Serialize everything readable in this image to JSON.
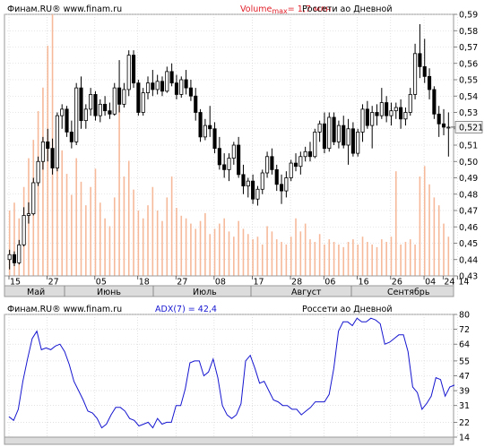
{
  "header_main": {
    "brand": "Финам.RU® www.finam.ru",
    "volume_label": "Volume",
    "volume_sub": "max",
    "volume_value": "= 1,7 млн",
    "title": "Россети ао Дневной"
  },
  "header_adx": {
    "brand": "Финам.RU® www.finam.ru",
    "indicator": "ADX(7) = 42,4",
    "title": "Россети ао Дневной"
  },
  "colors": {
    "up_body": "#ffffff",
    "down_body": "#000000",
    "volume": "#f6b99a",
    "adx_line": "#1515d0",
    "grid": "#cfcfcf",
    "last_price_box": "#f4f4f4"
  },
  "chart_data": [
    {
      "type": "candlestick",
      "title": "Россети ао Дневной",
      "y_ticks": [
        "0,59",
        "0,58",
        "0,57",
        "0,56",
        "0,55",
        "0,54",
        "0,53",
        "0,52",
        "0,51",
        "0,50",
        "0,49",
        "0,48",
        "0,47",
        "0,46",
        "0,45",
        "0,44",
        "0,43"
      ],
      "ylim": [
        0.43,
        0.59
      ],
      "last_price_label": "0,521",
      "last_price": 0.521,
      "x_day_labels": [
        "15",
        "27",
        "05",
        "18",
        "27",
        "08",
        "17",
        "28",
        "06",
        "16",
        "26",
        "04",
        "14",
        "24"
      ],
      "x_month_labels": [
        "Май",
        "Июнь",
        "Июль",
        "Август",
        "Сентябрь"
      ],
      "grid": true,
      "candles": [
        [
          0.44,
          0.446,
          0.434,
          0.443
        ],
        [
          0.443,
          0.445,
          0.436,
          0.438
        ],
        [
          0.438,
          0.452,
          0.437,
          0.449
        ],
        [
          0.449,
          0.472,
          0.448,
          0.467
        ],
        [
          0.467,
          0.475,
          0.462,
          0.468
        ],
        [
          0.468,
          0.49,
          0.467,
          0.487
        ],
        [
          0.487,
          0.503,
          0.485,
          0.5
        ],
        [
          0.5,
          0.515,
          0.495,
          0.512
        ],
        [
          0.512,
          0.52,
          0.5,
          0.508
        ],
        [
          0.508,
          0.514,
          0.492,
          0.496
        ],
        [
          0.496,
          0.53,
          0.494,
          0.528
        ],
        [
          0.528,
          0.535,
          0.52,
          0.532
        ],
        [
          0.532,
          0.534,
          0.515,
          0.518
        ],
        [
          0.518,
          0.525,
          0.508,
          0.512
        ],
        [
          0.512,
          0.548,
          0.51,
          0.545
        ],
        [
          0.545,
          0.552,
          0.52,
          0.525
        ],
        [
          0.525,
          0.535,
          0.52,
          0.532
        ],
        [
          0.532,
          0.545,
          0.528,
          0.541
        ],
        [
          0.541,
          0.543,
          0.525,
          0.528
        ],
        [
          0.528,
          0.538,
          0.524,
          0.535
        ],
        [
          0.535,
          0.54,
          0.528,
          0.531
        ],
        [
          0.531,
          0.536,
          0.526,
          0.529
        ],
        [
          0.529,
          0.548,
          0.528,
          0.545
        ],
        [
          0.545,
          0.562,
          0.53,
          0.535
        ],
        [
          0.535,
          0.548,
          0.533,
          0.544
        ],
        [
          0.544,
          0.568,
          0.54,
          0.565
        ],
        [
          0.565,
          0.568,
          0.545,
          0.548
        ],
        [
          0.548,
          0.55,
          0.528,
          0.53
        ],
        [
          0.53,
          0.545,
          0.528,
          0.542
        ],
        [
          0.542,
          0.552,
          0.538,
          0.548
        ],
        [
          0.548,
          0.556,
          0.54,
          0.544
        ],
        [
          0.544,
          0.553,
          0.541,
          0.549
        ],
        [
          0.549,
          0.552,
          0.54,
          0.543
        ],
        [
          0.543,
          0.558,
          0.542,
          0.555
        ],
        [
          0.555,
          0.56,
          0.546,
          0.548
        ],
        [
          0.548,
          0.553,
          0.538,
          0.541
        ],
        [
          0.541,
          0.552,
          0.539,
          0.55
        ],
        [
          0.55,
          0.556,
          0.541,
          0.545
        ],
        [
          0.545,
          0.55,
          0.537,
          0.54
        ],
        [
          0.54,
          0.545,
          0.525,
          0.53
        ],
        [
          0.53,
          0.532,
          0.512,
          0.515
        ],
        [
          0.515,
          0.526,
          0.513,
          0.522
        ],
        [
          0.522,
          0.534,
          0.515,
          0.52
        ],
        [
          0.52,
          0.524,
          0.505,
          0.508
        ],
        [
          0.508,
          0.515,
          0.495,
          0.498
        ],
        [
          0.498,
          0.505,
          0.49,
          0.495
        ],
        [
          0.495,
          0.505,
          0.488,
          0.502
        ],
        [
          0.502,
          0.512,
          0.498,
          0.51
        ],
        [
          0.51,
          0.515,
          0.49,
          0.492
        ],
        [
          0.492,
          0.498,
          0.48,
          0.485
        ],
        [
          0.485,
          0.49,
          0.478,
          0.488
        ],
        [
          0.488,
          0.492,
          0.474,
          0.477
        ],
        [
          0.477,
          0.485,
          0.473,
          0.483
        ],
        [
          0.483,
          0.495,
          0.48,
          0.493
        ],
        [
          0.493,
          0.506,
          0.49,
          0.503
        ],
        [
          0.503,
          0.508,
          0.492,
          0.495
        ],
        [
          0.495,
          0.498,
          0.482,
          0.486
        ],
        [
          0.486,
          0.492,
          0.474,
          0.482
        ],
        [
          0.482,
          0.494,
          0.478,
          0.49
        ],
        [
          0.49,
          0.501,
          0.488,
          0.499
        ],
        [
          0.499,
          0.505,
          0.494,
          0.497
        ],
        [
          0.497,
          0.506,
          0.492,
          0.503
        ],
        [
          0.503,
          0.509,
          0.5,
          0.506
        ],
        [
          0.506,
          0.512,
          0.5,
          0.503
        ],
        [
          0.503,
          0.52,
          0.502,
          0.518
        ],
        [
          0.518,
          0.525,
          0.512,
          0.523
        ],
        [
          0.523,
          0.53,
          0.505,
          0.508
        ],
        [
          0.508,
          0.53,
          0.506,
          0.527
        ],
        [
          0.527,
          0.53,
          0.51,
          0.512
        ],
        [
          0.512,
          0.525,
          0.508,
          0.522
        ],
        [
          0.522,
          0.528,
          0.508,
          0.51
        ],
        [
          0.51,
          0.526,
          0.498,
          0.52
        ],
        [
          0.52,
          0.524,
          0.503,
          0.505
        ],
        [
          0.505,
          0.52,
          0.503,
          0.518
        ],
        [
          0.518,
          0.535,
          0.512,
          0.532
        ],
        [
          0.532,
          0.537,
          0.52,
          0.522
        ],
        [
          0.522,
          0.534,
          0.508,
          0.53
        ],
        [
          0.53,
          0.535,
          0.522,
          0.528
        ],
        [
          0.528,
          0.545,
          0.526,
          0.536
        ],
        [
          0.536,
          0.54,
          0.524,
          0.528
        ],
        [
          0.528,
          0.536,
          0.522,
          0.531
        ],
        [
          0.531,
          0.536,
          0.526,
          0.533
        ],
        [
          0.533,
          0.538,
          0.52,
          0.526
        ],
        [
          0.526,
          0.533,
          0.522,
          0.53
        ],
        [
          0.53,
          0.545,
          0.528,
          0.541
        ],
        [
          0.541,
          0.572,
          0.538,
          0.566
        ],
        [
          0.566,
          0.584,
          0.551,
          0.558
        ],
        [
          0.558,
          0.575,
          0.548,
          0.552
        ],
        [
          0.552,
          0.557,
          0.538,
          0.544
        ],
        [
          0.544,
          0.546,
          0.526,
          0.529
        ],
        [
          0.529,
          0.534,
          0.515,
          0.523
        ],
        [
          0.523,
          0.532,
          0.516,
          0.521
        ],
        [
          0.521,
          0.53,
          0.503,
          0.521
        ]
      ],
      "volume_bars": [
        0.25,
        0.28,
        0.22,
        0.34,
        0.45,
        0.52,
        0.63,
        0.72,
        0.88,
        1.0,
        0.58,
        0.48,
        0.39,
        0.31,
        0.45,
        0.36,
        0.27,
        0.34,
        0.41,
        0.28,
        0.22,
        0.19,
        0.3,
        0.65,
        0.38,
        0.44,
        0.33,
        0.25,
        0.22,
        0.27,
        0.34,
        0.25,
        0.21,
        0.3,
        0.38,
        0.26,
        0.23,
        0.22,
        0.2,
        0.18,
        0.21,
        0.24,
        0.16,
        0.18,
        0.2,
        0.22,
        0.17,
        0.15,
        0.21,
        0.18,
        0.16,
        0.14,
        0.15,
        0.12,
        0.19,
        0.17,
        0.14,
        0.13,
        0.12,
        0.15,
        0.22,
        0.17,
        0.2,
        0.14,
        0.13,
        0.16,
        0.12,
        0.14,
        0.13,
        0.12,
        0.11,
        0.13,
        0.14,
        0.12,
        0.15,
        0.13,
        0.12,
        0.11,
        0.14,
        0.13,
        0.15,
        0.4,
        0.12,
        0.13,
        0.14,
        0.12,
        0.38,
        0.42,
        0.35,
        0.3,
        0.27,
        0.2,
        0.15
      ]
    },
    {
      "type": "line",
      "title": "Россети ао Дневной",
      "series_name": "ADX(7)",
      "last_value_label": "42,4",
      "y_ticks": [
        "80",
        "72",
        "64",
        "55",
        "47",
        "39",
        "31",
        "22",
        "14"
      ],
      "ylim": [
        14,
        80
      ],
      "grid": true,
      "values": [
        25,
        23,
        29,
        44,
        56,
        67,
        71,
        61,
        62,
        61,
        63,
        64,
        60,
        53,
        44,
        39,
        34,
        28,
        27,
        24,
        19,
        21,
        26,
        30,
        30,
        28,
        24,
        23,
        20,
        21,
        22,
        19,
        24,
        21,
        22,
        22,
        31,
        31,
        40,
        54,
        55,
        55,
        47,
        49,
        56,
        46,
        31,
        26,
        24,
        26,
        32,
        55,
        58,
        51,
        43,
        44,
        39,
        34,
        33,
        31,
        31,
        29,
        29,
        26,
        28,
        30,
        33,
        33,
        33,
        37,
        51,
        71,
        76,
        76,
        74,
        78,
        76,
        76,
        78,
        77,
        75,
        64,
        65,
        67,
        69,
        69,
        60,
        41,
        38,
        29,
        32,
        36,
        46,
        45,
        36,
        41,
        42
      ]
    }
  ]
}
